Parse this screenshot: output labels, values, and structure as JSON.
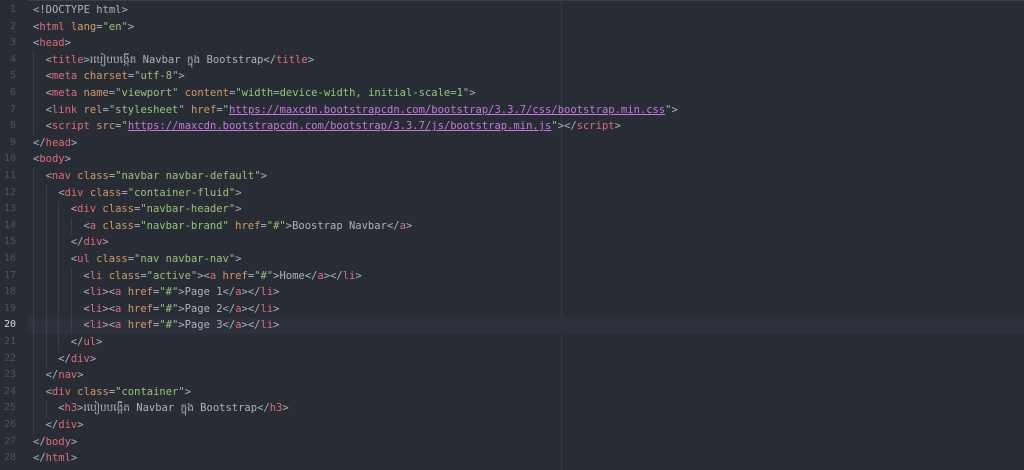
{
  "editor": {
    "current_line": 20,
    "colors": {
      "background": "#282c34",
      "tag": "#e06c75",
      "attribute": "#d19a66",
      "string": "#98c379",
      "text": "#abb2bf",
      "url": "#c678dd",
      "gutter_number": "#4b5263"
    },
    "lines": [
      {
        "num": "1",
        "indent": 0,
        "tokens": [
          {
            "t": "text",
            "v": "<!DOCTYPE html>"
          }
        ]
      },
      {
        "num": "2",
        "indent": 0,
        "tokens": [
          {
            "t": "punct",
            "v": "<"
          },
          {
            "t": "tag",
            "v": "html"
          },
          {
            "t": "text",
            "v": " "
          },
          {
            "t": "attr",
            "v": "lang"
          },
          {
            "t": "punct",
            "v": "="
          },
          {
            "t": "str",
            "v": "\"en\""
          },
          {
            "t": "punct",
            "v": ">"
          }
        ]
      },
      {
        "num": "3",
        "indent": 0,
        "tokens": [
          {
            "t": "punct",
            "v": "<"
          },
          {
            "t": "tag",
            "v": "head"
          },
          {
            "t": "punct",
            "v": ">"
          }
        ]
      },
      {
        "num": "4",
        "indent": 1,
        "tokens": [
          {
            "t": "punct",
            "v": "<"
          },
          {
            "t": "tag",
            "v": "title"
          },
          {
            "t": "punct",
            "v": ">"
          },
          {
            "t": "text",
            "v": "របៀបបង្កើត Navbar ក្នុង Bootstrap"
          },
          {
            "t": "punct",
            "v": "</"
          },
          {
            "t": "tag",
            "v": "title"
          },
          {
            "t": "punct",
            "v": ">"
          }
        ]
      },
      {
        "num": "5",
        "indent": 1,
        "tokens": [
          {
            "t": "punct",
            "v": "<"
          },
          {
            "t": "tag",
            "v": "meta"
          },
          {
            "t": "text",
            "v": " "
          },
          {
            "t": "attr",
            "v": "charset"
          },
          {
            "t": "punct",
            "v": "="
          },
          {
            "t": "str",
            "v": "\"utf-8\""
          },
          {
            "t": "punct",
            "v": ">"
          }
        ]
      },
      {
        "num": "6",
        "indent": 1,
        "tokens": [
          {
            "t": "punct",
            "v": "<"
          },
          {
            "t": "tag",
            "v": "meta"
          },
          {
            "t": "text",
            "v": " "
          },
          {
            "t": "attr",
            "v": "name"
          },
          {
            "t": "punct",
            "v": "="
          },
          {
            "t": "str",
            "v": "\"viewport\""
          },
          {
            "t": "text",
            "v": " "
          },
          {
            "t": "attr",
            "v": "content"
          },
          {
            "t": "punct",
            "v": "="
          },
          {
            "t": "str",
            "v": "\"width=device-width, initial-scale=1\""
          },
          {
            "t": "punct",
            "v": ">"
          }
        ]
      },
      {
        "num": "7",
        "indent": 1,
        "tokens": [
          {
            "t": "punct",
            "v": "<"
          },
          {
            "t": "tag",
            "v": "link"
          },
          {
            "t": "text",
            "v": " "
          },
          {
            "t": "attr",
            "v": "rel"
          },
          {
            "t": "punct",
            "v": "="
          },
          {
            "t": "str",
            "v": "\"stylesheet\""
          },
          {
            "t": "text",
            "v": " "
          },
          {
            "t": "attr",
            "v": "href"
          },
          {
            "t": "punct",
            "v": "="
          },
          {
            "t": "str",
            "v": "\""
          },
          {
            "t": "url",
            "v": "https://maxcdn.bootstrapcdn.com/bootstrap/3.3.7/css/bootstrap.min.css"
          },
          {
            "t": "str",
            "v": "\""
          },
          {
            "t": "punct",
            "v": ">"
          }
        ]
      },
      {
        "num": "8",
        "indent": 1,
        "tokens": [
          {
            "t": "punct",
            "v": "<"
          },
          {
            "t": "tag",
            "v": "script"
          },
          {
            "t": "text",
            "v": " "
          },
          {
            "t": "attr",
            "v": "src"
          },
          {
            "t": "punct",
            "v": "="
          },
          {
            "t": "str",
            "v": "\""
          },
          {
            "t": "url",
            "v": "https://maxcdn.bootstrapcdn.com/bootstrap/3.3.7/js/bootstrap.min.js"
          },
          {
            "t": "str",
            "v": "\""
          },
          {
            "t": "punct",
            "v": "></"
          },
          {
            "t": "tag",
            "v": "script"
          },
          {
            "t": "punct",
            "v": ">"
          }
        ]
      },
      {
        "num": "9",
        "indent": 0,
        "tokens": [
          {
            "t": "punct",
            "v": "</"
          },
          {
            "t": "tag",
            "v": "head"
          },
          {
            "t": "punct",
            "v": ">"
          }
        ]
      },
      {
        "num": "10",
        "indent": 0,
        "tokens": [
          {
            "t": "punct",
            "v": "<"
          },
          {
            "t": "tag",
            "v": "body"
          },
          {
            "t": "punct",
            "v": ">"
          }
        ]
      },
      {
        "num": "11",
        "indent": 1,
        "tokens": [
          {
            "t": "punct",
            "v": "<"
          },
          {
            "t": "tag",
            "v": "nav"
          },
          {
            "t": "text",
            "v": " "
          },
          {
            "t": "attr",
            "v": "class"
          },
          {
            "t": "punct",
            "v": "="
          },
          {
            "t": "str",
            "v": "\"navbar navbar-default\""
          },
          {
            "t": "punct",
            "v": ">"
          }
        ]
      },
      {
        "num": "12",
        "indent": 2,
        "tokens": [
          {
            "t": "punct",
            "v": "<"
          },
          {
            "t": "tag",
            "v": "div"
          },
          {
            "t": "text",
            "v": " "
          },
          {
            "t": "attr",
            "v": "class"
          },
          {
            "t": "punct",
            "v": "="
          },
          {
            "t": "str",
            "v": "\"container-fluid\""
          },
          {
            "t": "punct",
            "v": ">"
          }
        ]
      },
      {
        "num": "13",
        "indent": 3,
        "tokens": [
          {
            "t": "punct",
            "v": "<"
          },
          {
            "t": "tag",
            "v": "div"
          },
          {
            "t": "text",
            "v": " "
          },
          {
            "t": "attr",
            "v": "class"
          },
          {
            "t": "punct",
            "v": "="
          },
          {
            "t": "str",
            "v": "\"navbar-header\""
          },
          {
            "t": "punct",
            "v": ">"
          }
        ]
      },
      {
        "num": "14",
        "indent": 4,
        "tokens": [
          {
            "t": "punct",
            "v": "<"
          },
          {
            "t": "tag",
            "v": "a"
          },
          {
            "t": "text",
            "v": " "
          },
          {
            "t": "attr",
            "v": "class"
          },
          {
            "t": "punct",
            "v": "="
          },
          {
            "t": "str",
            "v": "\"navbar-brand\""
          },
          {
            "t": "text",
            "v": " "
          },
          {
            "t": "attr",
            "v": "href"
          },
          {
            "t": "punct",
            "v": "="
          },
          {
            "t": "str",
            "v": "\"#\""
          },
          {
            "t": "punct",
            "v": ">"
          },
          {
            "t": "text",
            "v": "Boostrap Navbar"
          },
          {
            "t": "punct",
            "v": "</"
          },
          {
            "t": "tag",
            "v": "a"
          },
          {
            "t": "punct",
            "v": ">"
          }
        ]
      },
      {
        "num": "15",
        "indent": 3,
        "tokens": [
          {
            "t": "punct",
            "v": "</"
          },
          {
            "t": "tag",
            "v": "div"
          },
          {
            "t": "punct",
            "v": ">"
          }
        ]
      },
      {
        "num": "16",
        "indent": 3,
        "tokens": [
          {
            "t": "punct",
            "v": "<"
          },
          {
            "t": "tag",
            "v": "ul"
          },
          {
            "t": "text",
            "v": " "
          },
          {
            "t": "attr",
            "v": "class"
          },
          {
            "t": "punct",
            "v": "="
          },
          {
            "t": "str",
            "v": "\"nav navbar-nav\""
          },
          {
            "t": "punct",
            "v": ">"
          }
        ]
      },
      {
        "num": "17",
        "indent": 4,
        "tokens": [
          {
            "t": "punct",
            "v": "<"
          },
          {
            "t": "tag",
            "v": "li"
          },
          {
            "t": "text",
            "v": " "
          },
          {
            "t": "attr",
            "v": "class"
          },
          {
            "t": "punct",
            "v": "="
          },
          {
            "t": "str",
            "v": "\"active\""
          },
          {
            "t": "punct",
            "v": "><"
          },
          {
            "t": "tag",
            "v": "a"
          },
          {
            "t": "text",
            "v": " "
          },
          {
            "t": "attr",
            "v": "href"
          },
          {
            "t": "punct",
            "v": "="
          },
          {
            "t": "str",
            "v": "\"#\""
          },
          {
            "t": "punct",
            "v": ">"
          },
          {
            "t": "text",
            "v": "Home"
          },
          {
            "t": "punct",
            "v": "</"
          },
          {
            "t": "tag",
            "v": "a"
          },
          {
            "t": "punct",
            "v": "></"
          },
          {
            "t": "tag",
            "v": "li"
          },
          {
            "t": "punct",
            "v": ">"
          }
        ]
      },
      {
        "num": "18",
        "indent": 4,
        "tokens": [
          {
            "t": "punct",
            "v": "<"
          },
          {
            "t": "tag",
            "v": "li"
          },
          {
            "t": "punct",
            "v": "><"
          },
          {
            "t": "tag",
            "v": "a"
          },
          {
            "t": "text",
            "v": " "
          },
          {
            "t": "attr",
            "v": "href"
          },
          {
            "t": "punct",
            "v": "="
          },
          {
            "t": "str",
            "v": "\"#\""
          },
          {
            "t": "punct",
            "v": ">"
          },
          {
            "t": "text",
            "v": "Page 1"
          },
          {
            "t": "punct",
            "v": "</"
          },
          {
            "t": "tag",
            "v": "a"
          },
          {
            "t": "punct",
            "v": "></"
          },
          {
            "t": "tag",
            "v": "li"
          },
          {
            "t": "punct",
            "v": ">"
          }
        ]
      },
      {
        "num": "19",
        "indent": 4,
        "tokens": [
          {
            "t": "punct",
            "v": "<"
          },
          {
            "t": "tag",
            "v": "li"
          },
          {
            "t": "punct",
            "v": "><"
          },
          {
            "t": "tag",
            "v": "a"
          },
          {
            "t": "text",
            "v": " "
          },
          {
            "t": "attr",
            "v": "href"
          },
          {
            "t": "punct",
            "v": "="
          },
          {
            "t": "str",
            "v": "\"#\""
          },
          {
            "t": "punct",
            "v": ">"
          },
          {
            "t": "text",
            "v": "Page 2"
          },
          {
            "t": "punct",
            "v": "</"
          },
          {
            "t": "tag",
            "v": "a"
          },
          {
            "t": "punct",
            "v": "></"
          },
          {
            "t": "tag",
            "v": "li"
          },
          {
            "t": "punct",
            "v": ">"
          }
        ]
      },
      {
        "num": "20",
        "indent": 4,
        "tokens": [
          {
            "t": "punct",
            "v": "<"
          },
          {
            "t": "tag",
            "v": "li"
          },
          {
            "t": "punct",
            "v": "><"
          },
          {
            "t": "tag",
            "v": "a"
          },
          {
            "t": "text",
            "v": " "
          },
          {
            "t": "attr",
            "v": "href"
          },
          {
            "t": "punct",
            "v": "="
          },
          {
            "t": "str",
            "v": "\"#\""
          },
          {
            "t": "punct",
            "v": ">"
          },
          {
            "t": "text",
            "v": "Page 3"
          },
          {
            "t": "punct",
            "v": "</"
          },
          {
            "t": "tag",
            "v": "a"
          },
          {
            "t": "punct",
            "v": "></"
          },
          {
            "t": "tag",
            "v": "li"
          },
          {
            "t": "punct",
            "v": ">"
          }
        ]
      },
      {
        "num": "21",
        "indent": 3,
        "tokens": [
          {
            "t": "punct",
            "v": "</"
          },
          {
            "t": "tag",
            "v": "ul"
          },
          {
            "t": "punct",
            "v": ">"
          }
        ]
      },
      {
        "num": "22",
        "indent": 2,
        "tokens": [
          {
            "t": "punct",
            "v": "</"
          },
          {
            "t": "tag",
            "v": "div"
          },
          {
            "t": "punct",
            "v": ">"
          }
        ]
      },
      {
        "num": "23",
        "indent": 1,
        "tokens": [
          {
            "t": "punct",
            "v": "</"
          },
          {
            "t": "tag",
            "v": "nav"
          },
          {
            "t": "punct",
            "v": ">"
          }
        ]
      },
      {
        "num": "24",
        "indent": 1,
        "tokens": [
          {
            "t": "punct",
            "v": "<"
          },
          {
            "t": "tag",
            "v": "div"
          },
          {
            "t": "text",
            "v": " "
          },
          {
            "t": "attr",
            "v": "class"
          },
          {
            "t": "punct",
            "v": "="
          },
          {
            "t": "str",
            "v": "\"container\""
          },
          {
            "t": "punct",
            "v": ">"
          }
        ]
      },
      {
        "num": "25",
        "indent": 2,
        "tokens": [
          {
            "t": "punct",
            "v": "<"
          },
          {
            "t": "tag",
            "v": "h3"
          },
          {
            "t": "punct",
            "v": ">"
          },
          {
            "t": "text",
            "v": "របៀបបង្កើត Navbar ក្នុង Bootstrap"
          },
          {
            "t": "punct",
            "v": "</"
          },
          {
            "t": "tag",
            "v": "h3"
          },
          {
            "t": "punct",
            "v": ">"
          }
        ]
      },
      {
        "num": "26",
        "indent": 1,
        "tokens": [
          {
            "t": "punct",
            "v": "</"
          },
          {
            "t": "tag",
            "v": "div"
          },
          {
            "t": "punct",
            "v": ">"
          }
        ]
      },
      {
        "num": "27",
        "indent": 0,
        "tokens": [
          {
            "t": "punct",
            "v": "</"
          },
          {
            "t": "tag",
            "v": "body"
          },
          {
            "t": "punct",
            "v": ">"
          }
        ]
      },
      {
        "num": "28",
        "indent": 0,
        "tokens": [
          {
            "t": "punct",
            "v": "</"
          },
          {
            "t": "tag",
            "v": "html"
          },
          {
            "t": "punct",
            "v": ">"
          }
        ]
      }
    ]
  }
}
